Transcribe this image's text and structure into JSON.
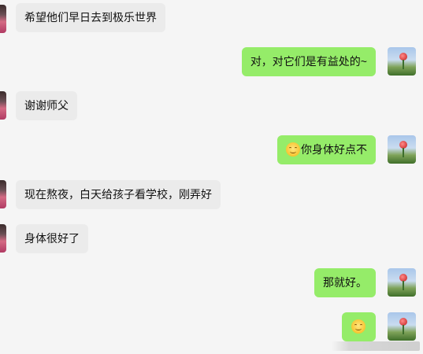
{
  "messages": [
    {
      "side": "left",
      "text": "希望他们早日去到极乐世界"
    },
    {
      "side": "right",
      "text": "对，对它们是有益处的~"
    },
    {
      "side": "left",
      "text": "谢谢师父"
    },
    {
      "side": "right",
      "emoji": "smile-emoji",
      "text": "你身体好点不"
    },
    {
      "side": "left",
      "text": "现在熬夜，白天给孩子看学校，刚弄好"
    },
    {
      "side": "left",
      "text": "身体很好了"
    },
    {
      "side": "right",
      "text": "那就好。"
    },
    {
      "side": "right",
      "emoji": "smile-emoji",
      "text": ""
    }
  ],
  "colors": {
    "background": "#f5f5f5",
    "incoming_bubble": "#ebebeb",
    "outgoing_bubble": "#95ec69"
  }
}
